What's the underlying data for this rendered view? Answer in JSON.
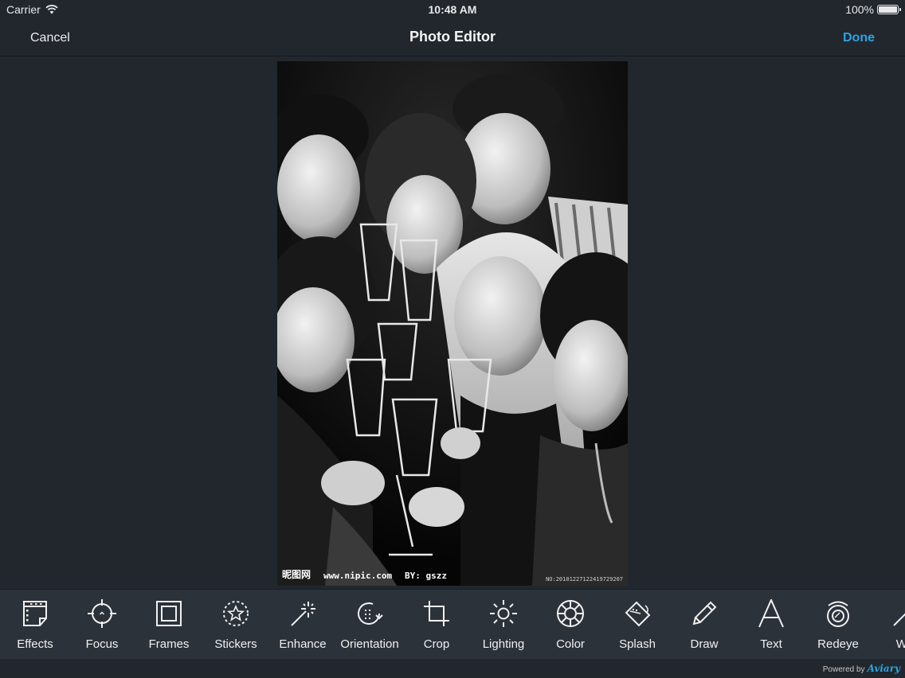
{
  "status": {
    "carrier": "Carrier",
    "time": "10:48 AM",
    "battery_text": "100%",
    "battery_level": 1.0
  },
  "nav": {
    "cancel": "Cancel",
    "title": "Photo Editor",
    "done": "Done"
  },
  "photo": {
    "watermark_cn": "昵图网",
    "watermark_url": "www.nipic.com",
    "watermark_by": "BY: gszz",
    "watermark_no": "NO:20101227122419729207"
  },
  "tools": [
    {
      "label": "Effects",
      "icon": "film-frame-icon"
    },
    {
      "label": "Focus",
      "icon": "crosshair-icon"
    },
    {
      "label": "Frames",
      "icon": "frame-square-icon"
    },
    {
      "label": "Stickers",
      "icon": "star-sticker-icon"
    },
    {
      "label": "Enhance",
      "icon": "magic-wand-icon"
    },
    {
      "label": "Orientation",
      "icon": "rotate-icon"
    },
    {
      "label": "Crop",
      "icon": "crop-icon"
    },
    {
      "label": "Lighting",
      "icon": "sun-icon"
    },
    {
      "label": "Color",
      "icon": "color-wheel-icon"
    },
    {
      "label": "Splash",
      "icon": "paint-bucket-icon"
    },
    {
      "label": "Draw",
      "icon": "pencil-icon"
    },
    {
      "label": "Text",
      "icon": "text-a-icon"
    },
    {
      "label": "Redeye",
      "icon": "eye-icon"
    },
    {
      "label": "Wh",
      "icon": "whiten-brush-icon"
    }
  ],
  "footer": {
    "powered_by": "Powered by",
    "brand": "Aviary"
  },
  "colors": {
    "accent": "#2ba4df",
    "background": "#22272e",
    "toolbar": "#2c323a"
  }
}
